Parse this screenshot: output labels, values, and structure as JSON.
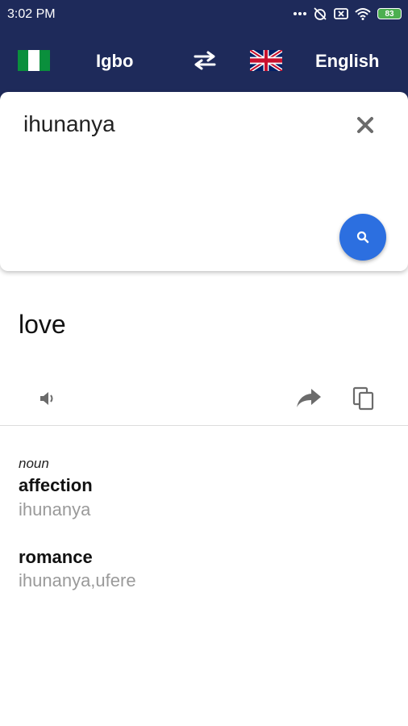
{
  "status_bar": {
    "time": "3:02 PM",
    "battery": "83"
  },
  "languages": {
    "source": "Igbo",
    "target": "English"
  },
  "input": {
    "text": "ihunanya"
  },
  "result": {
    "translation": "love"
  },
  "dictionary": {
    "part_of_speech": "noun",
    "entries": [
      {
        "word": "affection",
        "synonyms": "ihunanya"
      },
      {
        "word": "romance",
        "synonyms": "ihunanya,ufere"
      }
    ]
  },
  "colors": {
    "header_bg": "#1e2a5a",
    "accent": "#2c6fe0",
    "muted_text": "#9a9a9a"
  },
  "icons": {
    "swap": "swap-arrows-icon",
    "clear": "close-icon",
    "search": "search-icon",
    "speaker": "speaker-icon",
    "share": "share-icon",
    "copy": "copy-icon"
  }
}
